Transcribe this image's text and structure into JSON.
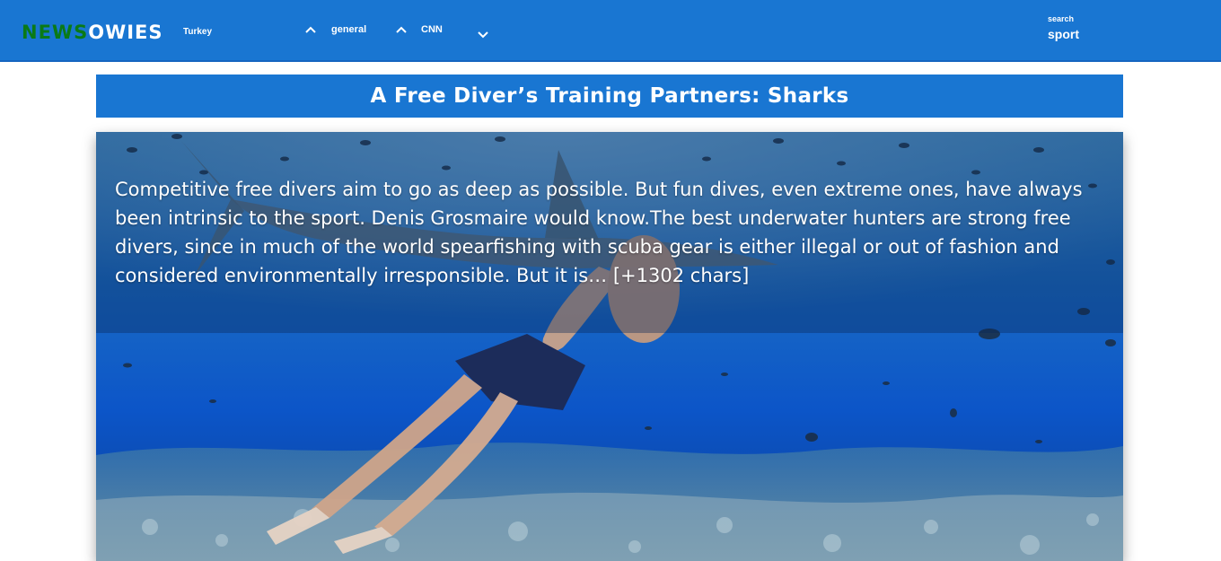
{
  "brand": {
    "part1": "NEWS",
    "part2": "OWIES"
  },
  "nav": {
    "country": "Turkey",
    "category": "general",
    "source": "CNN",
    "search_label": "search",
    "search_value": "sport"
  },
  "article": {
    "title": "A Free Diver’s Training Partners: Sharks",
    "description": "Competitive free divers aim to go as deep as possible. But fun dives, even extreme ones, have always been intrinsic to the sport. Denis Grosmaire would know.The best underwater hunters are strong free divers, since in much of the world spearfishing with scuba gear is either illegal or out of fashion and considered environmentally irresponsible. But it is… [+1302 chars]"
  },
  "icons": {
    "category_toggle": "chevron-up-icon",
    "source_toggle": "chevron-up-icon",
    "more": "chevron-down-icon"
  },
  "colors": {
    "navbar": "#1976d2",
    "brand_accent": "#0a7a16",
    "text": "#ffffff"
  }
}
